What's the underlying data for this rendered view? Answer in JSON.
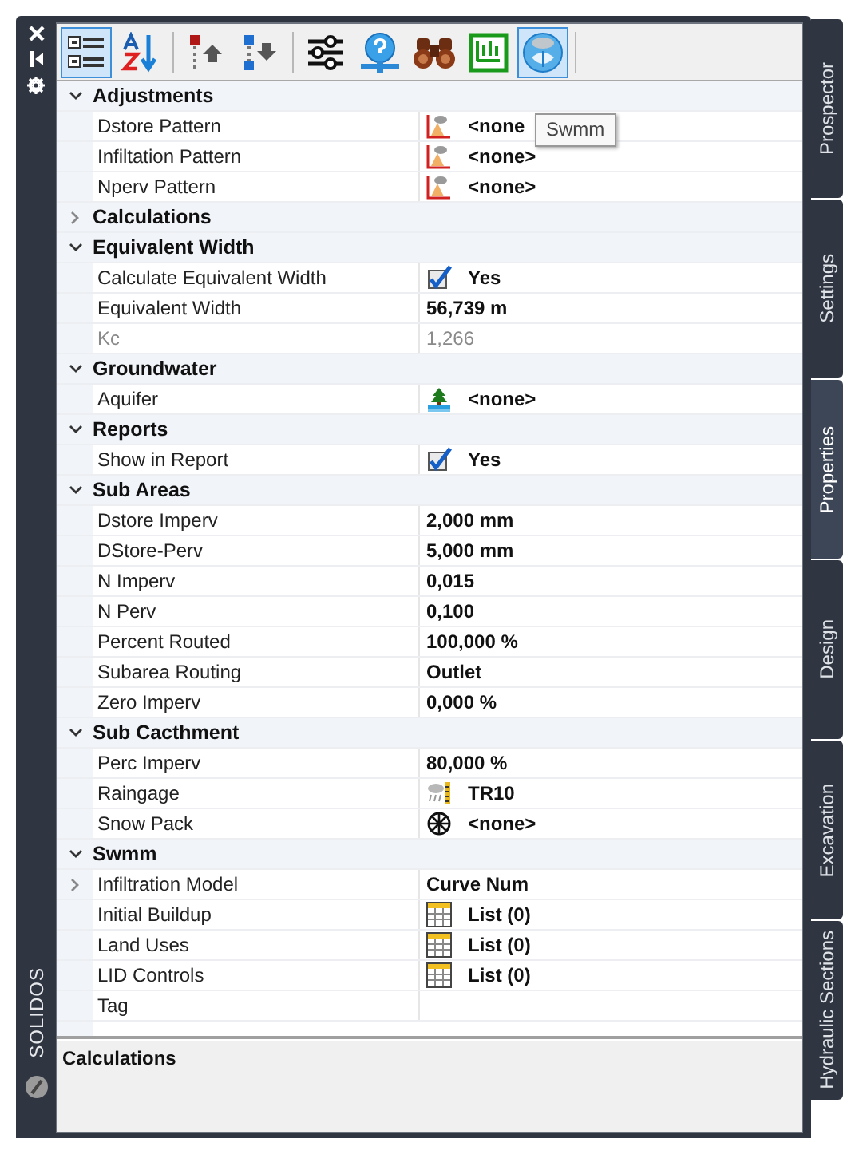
{
  "side_strip": {
    "label": "SOLIDOS"
  },
  "toolbar": [
    {
      "kind": "categorized",
      "selected": true
    },
    {
      "kind": "alphabetical",
      "selected": false
    },
    {
      "kind": "move-up",
      "selected": false
    },
    {
      "kind": "move-down",
      "selected": false
    },
    {
      "kind": "sliders",
      "selected": false
    },
    {
      "kind": "help",
      "selected": false
    },
    {
      "kind": "binoculars",
      "selected": false
    },
    {
      "kind": "chart",
      "selected": false
    },
    {
      "kind": "swmm",
      "selected": true
    }
  ],
  "tooltip": "Swmm",
  "categories": [
    {
      "name": "Adjustments",
      "expanded": true,
      "properties": [
        {
          "name": "Dstore Pattern",
          "kind": "pattern",
          "value": "<none",
          "disabled": false
        },
        {
          "name": "Infiltation Pattern",
          "kind": "pattern",
          "value": "<none>",
          "disabled": false
        },
        {
          "name": "Nperv Pattern",
          "kind": "pattern",
          "value": "<none>",
          "disabled": false
        }
      ]
    },
    {
      "name": "Calculations",
      "expanded": false
    },
    {
      "name": "Equivalent Width",
      "expanded": true,
      "properties": [
        {
          "name": "Calculate Equivalent Width",
          "kind": "check",
          "checked": true,
          "value": "Yes",
          "disabled": false
        },
        {
          "name": "Equivalent Width",
          "kind": "text",
          "value": "56,739 m",
          "disabled": false
        },
        {
          "name": "Kc",
          "kind": "text",
          "value": "1,266",
          "disabled": true
        }
      ]
    },
    {
      "name": "Groundwater",
      "expanded": true,
      "properties": [
        {
          "name": "Aquifer",
          "kind": "aquifer",
          "value": "<none>",
          "disabled": false
        }
      ]
    },
    {
      "name": "Reports",
      "expanded": true,
      "properties": [
        {
          "name": "Show in Report",
          "kind": "check",
          "checked": true,
          "value": "Yes",
          "disabled": false
        }
      ]
    },
    {
      "name": "Sub Areas",
      "expanded": true,
      "properties": [
        {
          "name": "Dstore Imperv",
          "kind": "text",
          "value": "2,000 mm",
          "disabled": false
        },
        {
          "name": "DStore-Perv",
          "kind": "text",
          "value": "5,000 mm",
          "disabled": false
        },
        {
          "name": "N Imperv",
          "kind": "text",
          "value": "0,015",
          "disabled": false
        },
        {
          "name": "N Perv",
          "kind": "text",
          "value": "0,100",
          "disabled": false
        },
        {
          "name": "Percent Routed",
          "kind": "text",
          "value": "100,000 %",
          "disabled": false
        },
        {
          "name": "Subarea Routing",
          "kind": "text",
          "value": "Outlet",
          "disabled": false
        },
        {
          "name": "Zero Imperv",
          "kind": "text",
          "value": "0,000 %",
          "disabled": false
        }
      ]
    },
    {
      "name": "Sub Cacthment",
      "expanded": true,
      "properties": [
        {
          "name": "Perc Imperv",
          "kind": "text",
          "value": "80,000 %",
          "disabled": false
        },
        {
          "name": "Raingage",
          "kind": "raingage",
          "value": "TR10",
          "disabled": false
        },
        {
          "name": "Snow Pack",
          "kind": "snow",
          "value": "<none>",
          "disabled": false
        }
      ]
    },
    {
      "name": "Swmm",
      "expanded": true,
      "properties": [
        {
          "name": "Infiltration Model",
          "kind": "text",
          "value": "Curve Num",
          "disabled": false,
          "expanded": false
        },
        {
          "name": "Initial Buildup",
          "kind": "list",
          "value": "List (0)",
          "disabled": false
        },
        {
          "name": "Land Uses",
          "kind": "list",
          "value": "List (0)",
          "disabled": false
        },
        {
          "name": "LID Controls",
          "kind": "list",
          "value": "List (0)",
          "disabled": false
        },
        {
          "name": "Tag",
          "kind": "empty",
          "disabled": false
        }
      ]
    }
  ],
  "description": {
    "title": "Calculations"
  },
  "tabs": [
    {
      "label": "Prospector",
      "selected": false
    },
    {
      "label": "Settings",
      "selected": false
    },
    {
      "label": "Properties",
      "selected": true
    },
    {
      "label": "Design",
      "selected": false
    },
    {
      "label": "Excavation",
      "selected": false
    },
    {
      "label": "Hydraulic Sections",
      "selected": false
    }
  ]
}
